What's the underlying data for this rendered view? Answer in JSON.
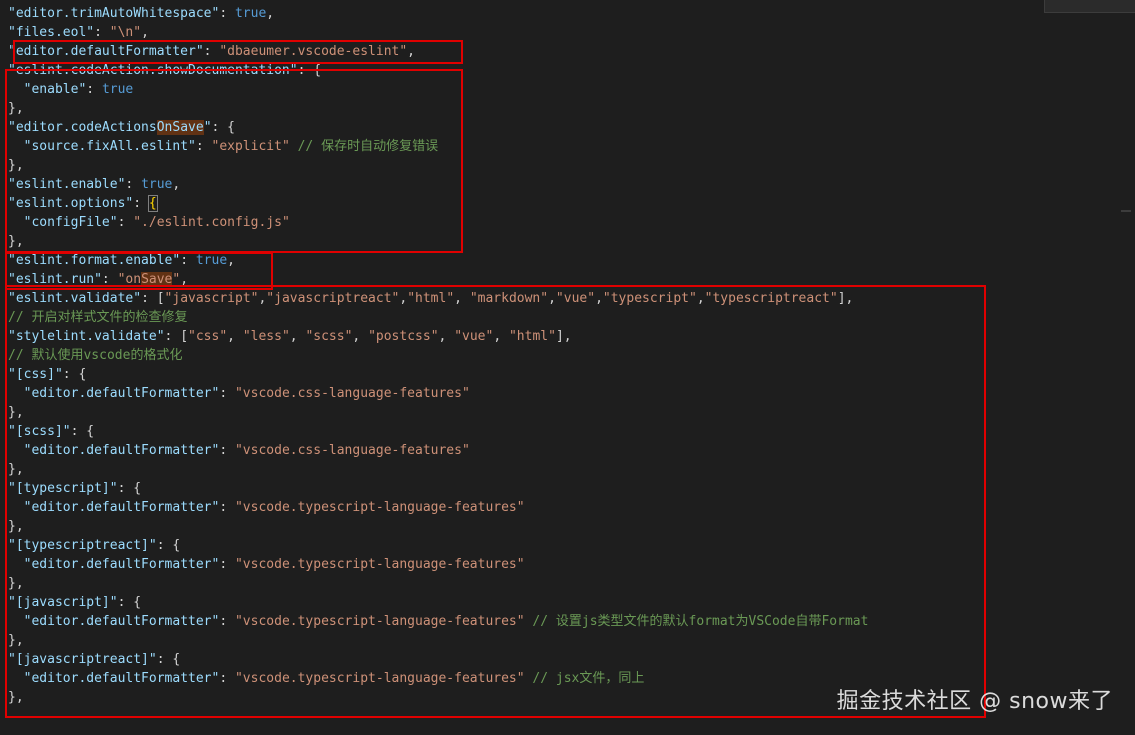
{
  "editor": {
    "lines": [
      [
        {
          "t": "\"editor.trimAutoWhitespace\"",
          "c": "key"
        },
        {
          "t": ": ",
          "c": "punc"
        },
        {
          "t": "true",
          "c": "bool"
        },
        {
          "t": ",",
          "c": "punc"
        }
      ],
      [
        {
          "t": "\"files.eol\"",
          "c": "key"
        },
        {
          "t": ": ",
          "c": "punc"
        },
        {
          "t": "\"\\n\"",
          "c": "str"
        },
        {
          "t": ",",
          "c": "punc"
        }
      ],
      [
        {
          "t": "\"editor.defaultFormatter\"",
          "c": "key"
        },
        {
          "t": ": ",
          "c": "punc"
        },
        {
          "t": "\"dbaeumer.vscode-eslint\"",
          "c": "str"
        },
        {
          "t": ",",
          "c": "punc"
        }
      ],
      [
        {
          "t": "\"eslint.codeAction.showDocumentation\"",
          "c": "key"
        },
        {
          "t": ": ",
          "c": "punc"
        },
        {
          "t": "{",
          "c": "brace"
        }
      ],
      [
        {
          "t": "  ",
          "c": "punc"
        },
        {
          "t": "\"enable\"",
          "c": "key"
        },
        {
          "t": ": ",
          "c": "punc"
        },
        {
          "t": "true",
          "c": "bool"
        }
      ],
      [
        {
          "t": "},",
          "c": "punc"
        }
      ],
      [
        {
          "t": "\"editor.codeActions",
          "c": "key"
        },
        {
          "t": "OnSave",
          "c": "key-hl"
        },
        {
          "t": "\"",
          "c": "key"
        },
        {
          "t": ": ",
          "c": "punc"
        },
        {
          "t": "{",
          "c": "brace"
        }
      ],
      [
        {
          "t": "  ",
          "c": "punc"
        },
        {
          "t": "\"source.fixAll.eslint\"",
          "c": "key"
        },
        {
          "t": ": ",
          "c": "punc"
        },
        {
          "t": "\"explicit\"",
          "c": "str"
        },
        {
          "t": " // 保存时自动修复错误",
          "c": "com"
        }
      ],
      [
        {
          "t": "},",
          "c": "punc"
        }
      ],
      [
        {
          "t": "\"eslint.enable\"",
          "c": "key"
        },
        {
          "t": ": ",
          "c": "punc"
        },
        {
          "t": "true",
          "c": "bool"
        },
        {
          "t": ",",
          "c": "punc"
        }
      ],
      [
        {
          "t": "\"eslint.options\"",
          "c": "key"
        },
        {
          "t": ": ",
          "c": "punc"
        },
        {
          "t": "{",
          "c": "brace-hl"
        }
      ],
      [
        {
          "t": "  ",
          "c": "punc"
        },
        {
          "t": "\"configFile\"",
          "c": "key"
        },
        {
          "t": ": ",
          "c": "punc"
        },
        {
          "t": "\"./eslint.config.js\"",
          "c": "str"
        }
      ],
      [
        {
          "t": "},",
          "c": "punc"
        }
      ],
      [
        {
          "t": "\"eslint.format.enable\"",
          "c": "key"
        },
        {
          "t": ": ",
          "c": "punc"
        },
        {
          "t": "true",
          "c": "bool"
        },
        {
          "t": ",",
          "c": "punc"
        }
      ],
      [
        {
          "t": "\"eslint.run\"",
          "c": "key"
        },
        {
          "t": ": ",
          "c": "punc"
        },
        {
          "t": "\"on",
          "c": "str"
        },
        {
          "t": "Save",
          "c": "str-hl"
        },
        {
          "t": "\"",
          "c": "str"
        },
        {
          "t": ",",
          "c": "punc"
        }
      ],
      [
        {
          "t": "\"eslint.validate\"",
          "c": "key"
        },
        {
          "t": ": [",
          "c": "punc"
        },
        {
          "t": "\"javascript\"",
          "c": "str"
        },
        {
          "t": ",",
          "c": "punc"
        },
        {
          "t": "\"javascriptreact\"",
          "c": "str"
        },
        {
          "t": ",",
          "c": "punc"
        },
        {
          "t": "\"html\"",
          "c": "str"
        },
        {
          "t": ", ",
          "c": "punc"
        },
        {
          "t": "\"markdown\"",
          "c": "str"
        },
        {
          "t": ",",
          "c": "punc"
        },
        {
          "t": "\"vue\"",
          "c": "str"
        },
        {
          "t": ",",
          "c": "punc"
        },
        {
          "t": "\"typescript\"",
          "c": "str"
        },
        {
          "t": ",",
          "c": "punc"
        },
        {
          "t": "\"typescriptreact\"",
          "c": "str"
        },
        {
          "t": "],",
          "c": "punc"
        }
      ],
      [
        {
          "t": "// 开启对样式文件的检查修复",
          "c": "com"
        }
      ],
      [
        {
          "t": "\"stylelint.validate\"",
          "c": "key"
        },
        {
          "t": ": [",
          "c": "punc"
        },
        {
          "t": "\"css\"",
          "c": "str"
        },
        {
          "t": ", ",
          "c": "punc"
        },
        {
          "t": "\"less\"",
          "c": "str"
        },
        {
          "t": ", ",
          "c": "punc"
        },
        {
          "t": "\"scss\"",
          "c": "str"
        },
        {
          "t": ", ",
          "c": "punc"
        },
        {
          "t": "\"postcss\"",
          "c": "str"
        },
        {
          "t": ", ",
          "c": "punc"
        },
        {
          "t": "\"vue\"",
          "c": "str"
        },
        {
          "t": ", ",
          "c": "punc"
        },
        {
          "t": "\"html\"",
          "c": "str"
        },
        {
          "t": "],",
          "c": "punc"
        }
      ],
      [
        {
          "t": "// 默认使用vscode的格式化",
          "c": "com"
        }
      ],
      [
        {
          "t": "\"[css]\"",
          "c": "key"
        },
        {
          "t": ": ",
          "c": "punc"
        },
        {
          "t": "{",
          "c": "brace"
        }
      ],
      [
        {
          "t": "  ",
          "c": "punc"
        },
        {
          "t": "\"editor.defaultFormatter\"",
          "c": "key"
        },
        {
          "t": ": ",
          "c": "punc"
        },
        {
          "t": "\"vscode.css-language-features\"",
          "c": "str"
        }
      ],
      [
        {
          "t": "},",
          "c": "punc"
        }
      ],
      [
        {
          "t": "\"[scss]\"",
          "c": "key"
        },
        {
          "t": ": ",
          "c": "punc"
        },
        {
          "t": "{",
          "c": "brace"
        }
      ],
      [
        {
          "t": "  ",
          "c": "punc"
        },
        {
          "t": "\"editor.defaultFormatter\"",
          "c": "key"
        },
        {
          "t": ": ",
          "c": "punc"
        },
        {
          "t": "\"vscode.css-language-features\"",
          "c": "str"
        }
      ],
      [
        {
          "t": "},",
          "c": "punc"
        }
      ],
      [
        {
          "t": "\"[typescript]\"",
          "c": "key"
        },
        {
          "t": ": ",
          "c": "punc"
        },
        {
          "t": "{",
          "c": "brace"
        }
      ],
      [
        {
          "t": "  ",
          "c": "punc"
        },
        {
          "t": "\"editor.defaultFormatter\"",
          "c": "key"
        },
        {
          "t": ": ",
          "c": "punc"
        },
        {
          "t": "\"vscode.typescript-language-features\"",
          "c": "str"
        }
      ],
      [
        {
          "t": "},",
          "c": "punc"
        }
      ],
      [
        {
          "t": "\"[typescriptreact]\"",
          "c": "key"
        },
        {
          "t": ": ",
          "c": "punc"
        },
        {
          "t": "{",
          "c": "brace"
        }
      ],
      [
        {
          "t": "  ",
          "c": "punc"
        },
        {
          "t": "\"editor.defaultFormatter\"",
          "c": "key"
        },
        {
          "t": ": ",
          "c": "punc"
        },
        {
          "t": "\"vscode.typescript-language-features\"",
          "c": "str"
        }
      ],
      [
        {
          "t": "},",
          "c": "punc"
        }
      ],
      [
        {
          "t": "\"[javascript]\"",
          "c": "key"
        },
        {
          "t": ": ",
          "c": "punc"
        },
        {
          "t": "{",
          "c": "brace"
        }
      ],
      [
        {
          "t": "  ",
          "c": "punc"
        },
        {
          "t": "\"editor.defaultFormatter\"",
          "c": "key"
        },
        {
          "t": ": ",
          "c": "punc"
        },
        {
          "t": "\"vscode.typescript-language-features\"",
          "c": "str"
        },
        {
          "t": " // 设置js类型文件的默认format为VSCode自带Format",
          "c": "com"
        }
      ],
      [
        {
          "t": "},",
          "c": "punc"
        }
      ],
      [
        {
          "t": "\"[javascriptreact]\"",
          "c": "key"
        },
        {
          "t": ": ",
          "c": "punc"
        },
        {
          "t": "{",
          "c": "brace"
        }
      ],
      [
        {
          "t": "  ",
          "c": "punc"
        },
        {
          "t": "\"editor.defaultFormatter\"",
          "c": "key"
        },
        {
          "t": ": ",
          "c": "punc"
        },
        {
          "t": "\"vscode.typescript-language-features\"",
          "c": "str"
        },
        {
          "t": " // jsx文件，同上",
          "c": "com"
        }
      ],
      [
        {
          "t": "},",
          "c": "punc"
        }
      ]
    ]
  },
  "watermark": {
    "text": "掘金技术社区 @ snow来了"
  },
  "colors": {
    "background": "#1e1e1e",
    "key": "#9cdcfe",
    "string": "#ce9178",
    "boolean": "#569cd6",
    "comment": "#6a9955",
    "annotation_box": "#e00000",
    "search_highlight": "#613214"
  }
}
